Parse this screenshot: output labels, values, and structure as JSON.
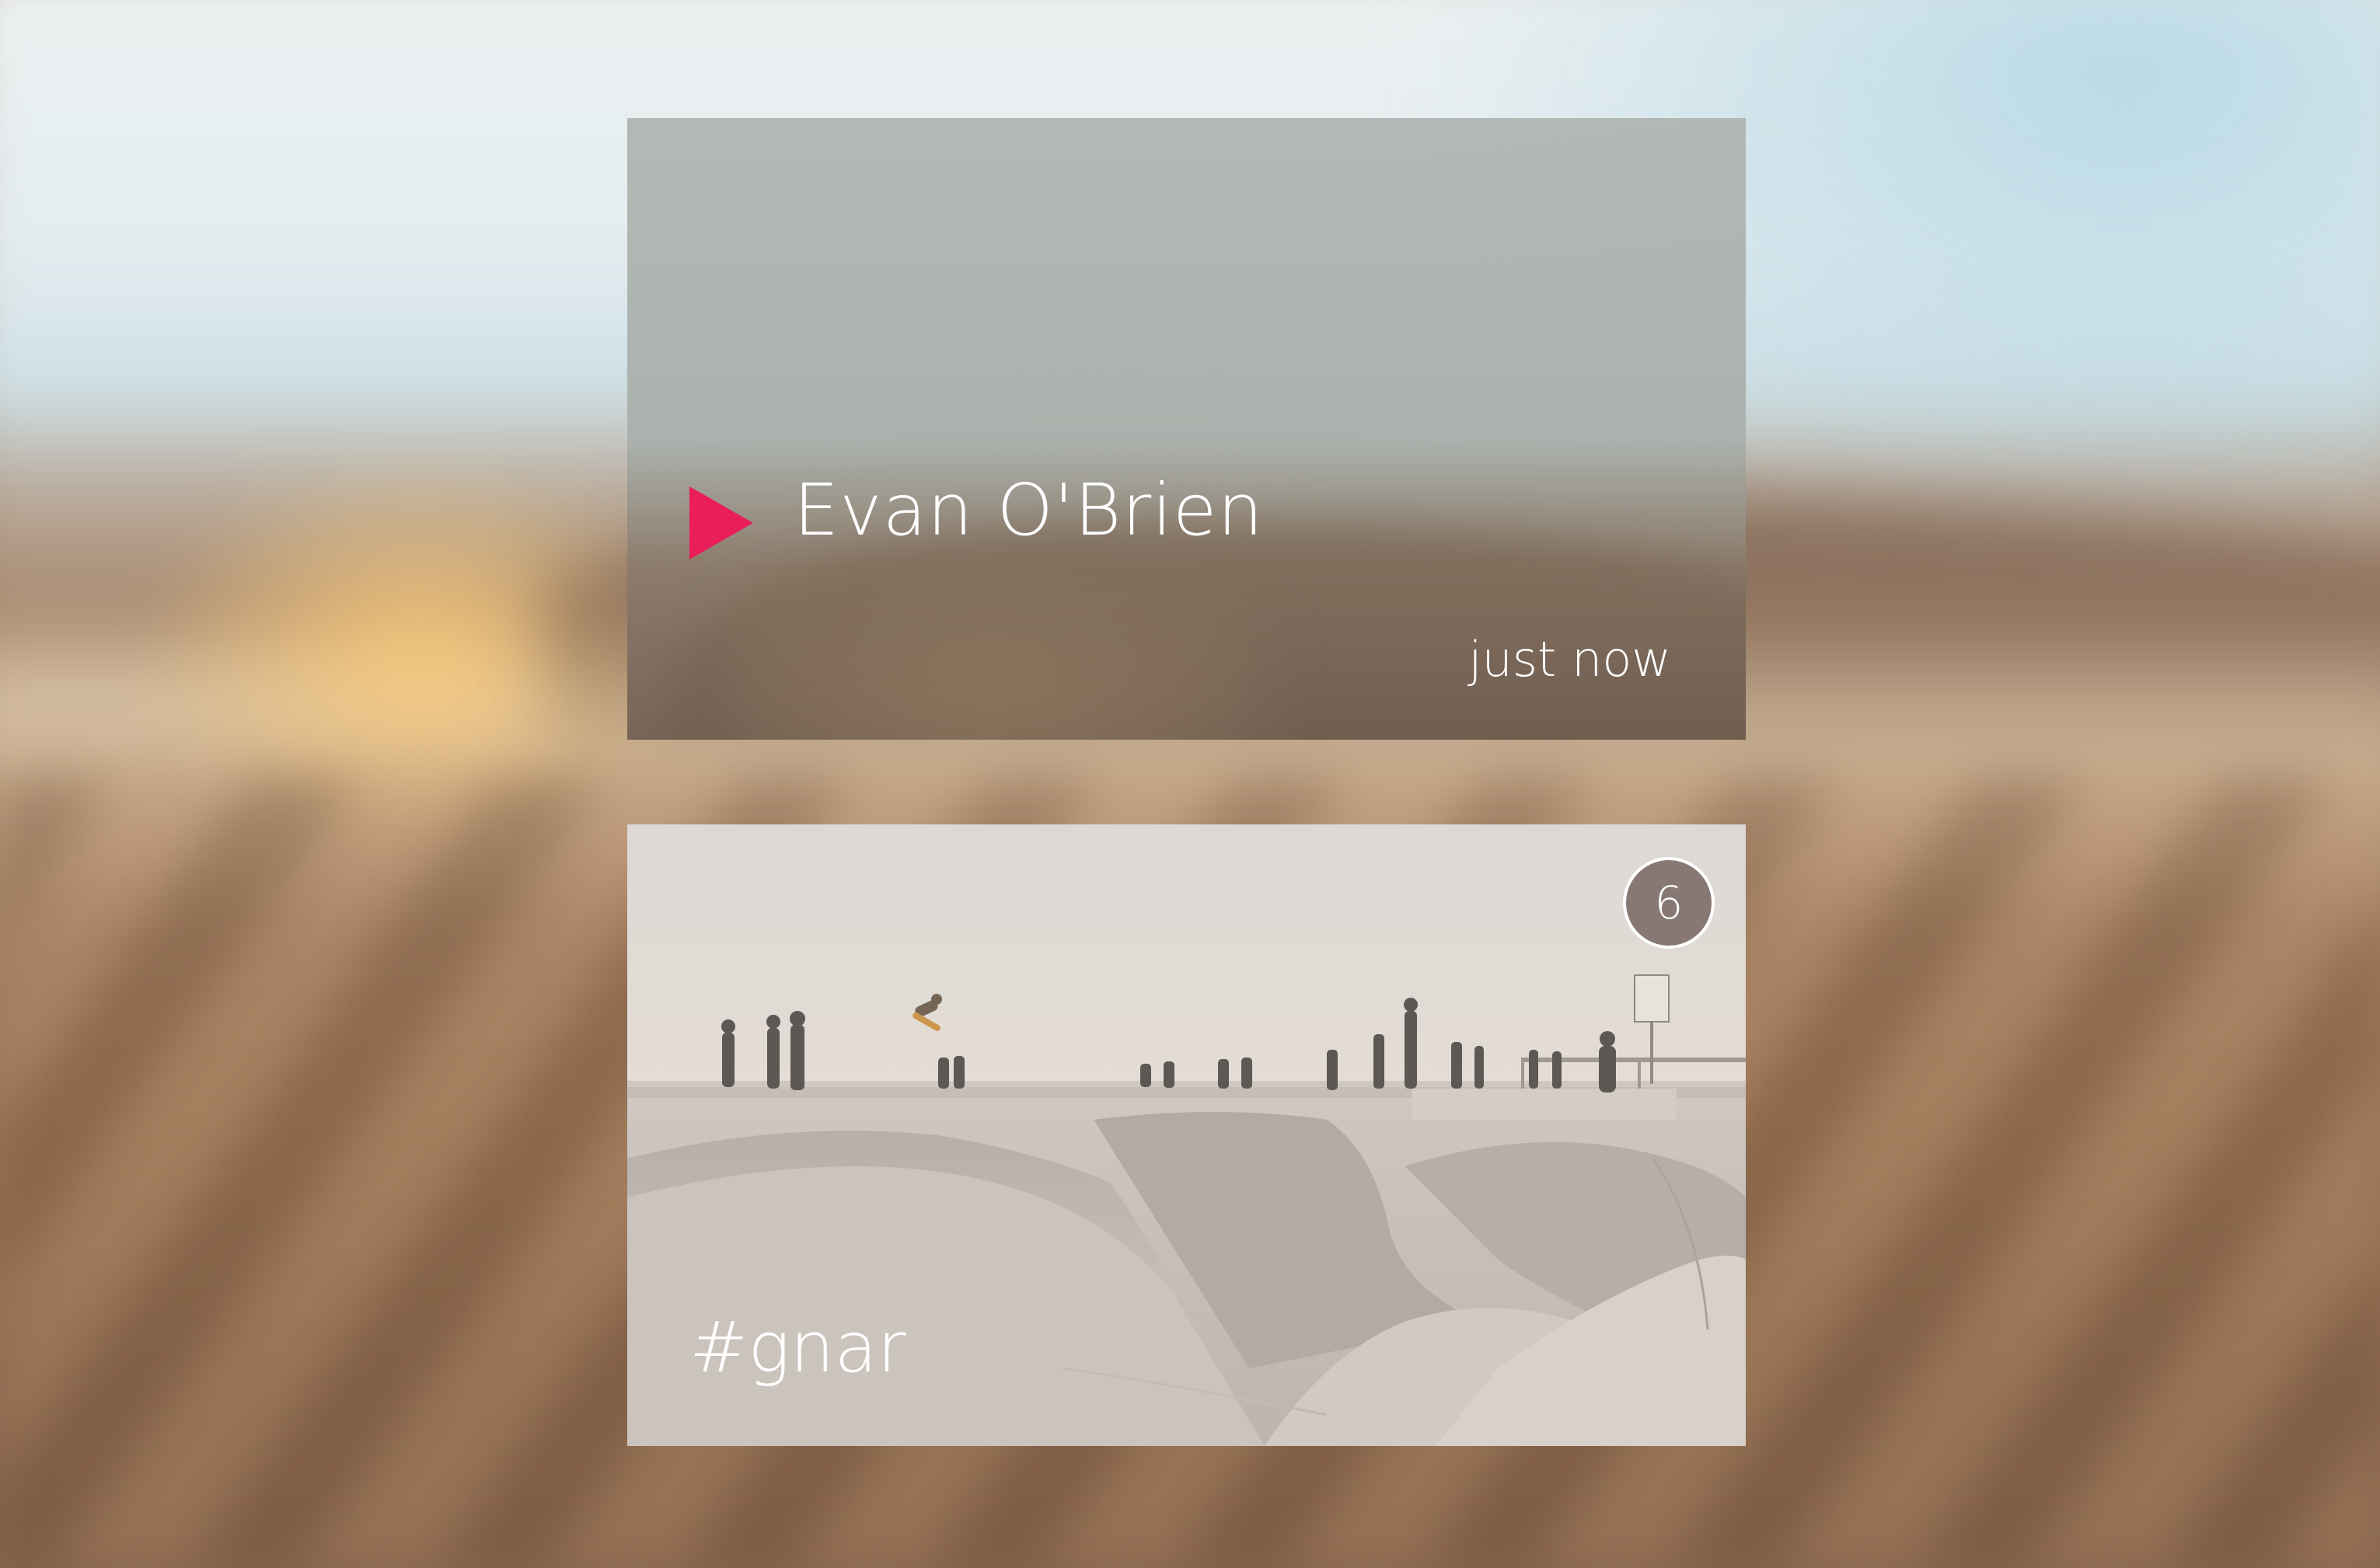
{
  "cards": [
    {
      "author": "Evan O'Brien",
      "timestamp": "just now",
      "icon": "play-icon",
      "accent_color": "#e91e5a"
    },
    {
      "hashtag": "#gnar",
      "count": "6",
      "image": "skatepark-photo"
    }
  ]
}
